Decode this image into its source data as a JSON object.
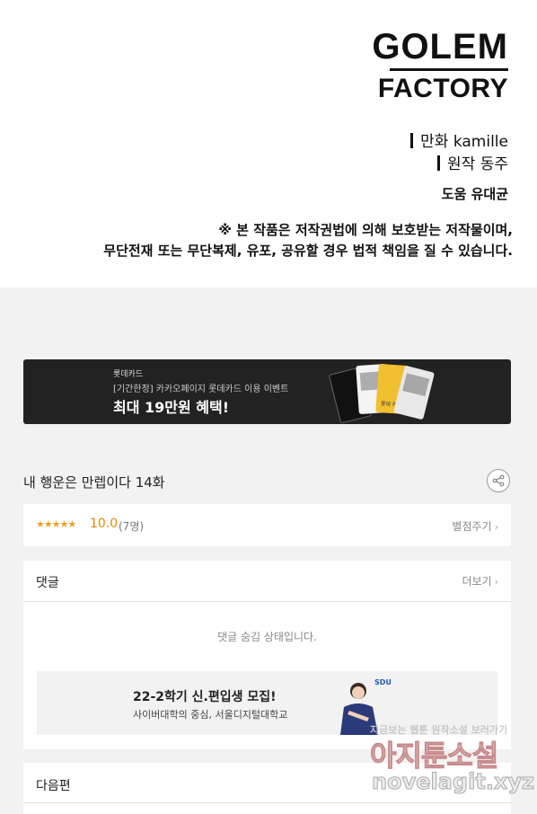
{
  "credits": {
    "logo_line1": "GOLEM",
    "logo_line2": "FACTORY",
    "art": "만화 kamille",
    "story": "원작 동주",
    "assist": "도움 유대균",
    "notice_line1": "※ 본 작품은 저작권법에 의해 보호받는 저작물이며,",
    "notice_line2": "무단전재 또는 무단복제, 유포, 공유할 경우 법적 책임을 질 수 있습니다."
  },
  "banner": {
    "brand": "롯데카드",
    "subtitle": "[기간한정] 카카오페이지 롯데카드 이용 이벤트",
    "headline": "최대 19만원 혜택!",
    "card_label": "롯데 카드"
  },
  "episode": {
    "title": "내 행운은 만렙이다 14화",
    "share_icon": "share-icon"
  },
  "rating": {
    "stars": "★★★★★",
    "score": "10.0",
    "count": "(7명)",
    "rate_button": "별점주기",
    "star_color": "#f0a020"
  },
  "comments": {
    "title": "댓글",
    "more": "더보기",
    "hidden_message": "댓글 숨김 상태입니다."
  },
  "ad": {
    "headline": "22-2학기 신.편입생 모집!",
    "subline": "사이버대학의 중심, 서울디지털대학교",
    "logo": "SDU"
  },
  "next": {
    "title": "다음편"
  },
  "watermark": {
    "line1": "지금보는 웹툰 원작소설 보러가기",
    "line2": "아지툰소설",
    "line3": "novelagit.xyz"
  }
}
